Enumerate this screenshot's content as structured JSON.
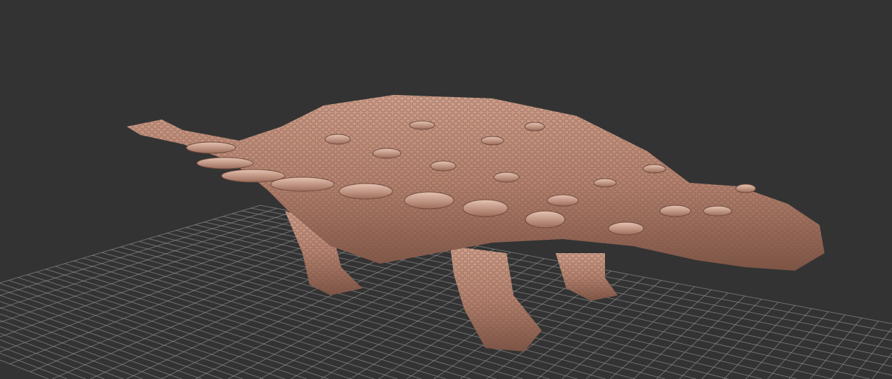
{
  "viewport": {
    "background_color": "#333333",
    "grid_color": "#8a8a8a",
    "model": {
      "subject_icon": "ankylosaurus-sculpt",
      "base_color": "#b98a78",
      "shadow_color": "#6e4a3e",
      "highlight_color": "#e3bfae"
    }
  }
}
